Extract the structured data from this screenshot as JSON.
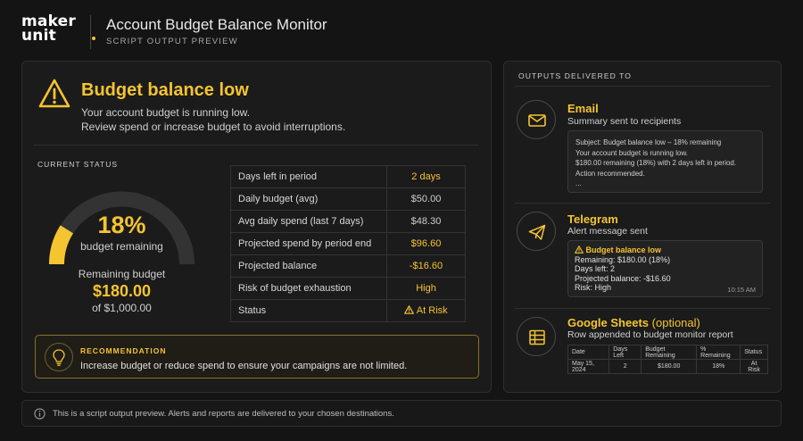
{
  "brand": {
    "line1": "maker",
    "line2": "unit"
  },
  "header": {
    "title": "Account Budget Balance Monitor",
    "subtitle": "SCRIPT OUTPUT PREVIEW"
  },
  "alert": {
    "title": "Budget balance low",
    "line1": "Your account budget is running low.",
    "line2": "Review spend or increase budget to avoid interruptions."
  },
  "status": {
    "label": "CURRENT STATUS",
    "percent_text": "18%",
    "percent_value": 18,
    "percent_caption": "budget remaining",
    "remaining_label": "Remaining budget",
    "remaining_value": "$180.00",
    "remaining_of": "of $1,000.00"
  },
  "metrics": [
    {
      "label": "Days left in period",
      "value": "2 days",
      "highlight": true
    },
    {
      "label": "Daily budget (avg)",
      "value": "$50.00",
      "highlight": false
    },
    {
      "label": "Avg daily spend (last 7 days)",
      "value": "$48.30",
      "highlight": false
    },
    {
      "label": "Projected spend by period end",
      "value": "$96.60",
      "highlight": true
    },
    {
      "label": "Projected balance",
      "value": "-$16.60",
      "highlight": true
    },
    {
      "label": "Risk of budget exhaustion",
      "value": "High",
      "highlight": true
    },
    {
      "label": "Status",
      "value": "At Risk",
      "highlight": true
    }
  ],
  "recommendation": {
    "heading": "RECOMMENDATION",
    "text": "Increase budget or reduce spend to ensure your campaigns are not limited."
  },
  "outputs": {
    "label": "OUTPUTS DELIVERED TO",
    "email": {
      "title": "Email",
      "subtitle": "Summary sent to recipients",
      "lines": [
        "Subject: Budget balance low – 18% remaining",
        "Your account budget is running low.",
        "$180.00 remaining (18%) with 2 days left in period.",
        "Action recommended.",
        "..."
      ]
    },
    "telegram": {
      "title": "Telegram",
      "subtitle": "Alert message sent",
      "head": "Budget balance low",
      "lines": [
        "Remaining: $180.00 (18%)",
        "Days left: 2",
        "Projected balance: -$16.60",
        "Risk: High"
      ],
      "time": "10:15 AM"
    },
    "sheets": {
      "title": "Google Sheets",
      "optional": "(optional)",
      "subtitle": "Row appended to budget monitor report",
      "headers": [
        "Date",
        "Days Left",
        "Budget Remaining",
        "% Remaining",
        "Status"
      ],
      "row": [
        "May 15, 2024",
        "2",
        "$180.00",
        "18%",
        "At Risk"
      ]
    }
  },
  "footer": {
    "text": "This is a script output preview. Alerts and reports are delivered to your chosen destinations."
  },
  "colors": {
    "accent": "#f5c431",
    "background": "#141414",
    "card": "#1b1b1b"
  }
}
